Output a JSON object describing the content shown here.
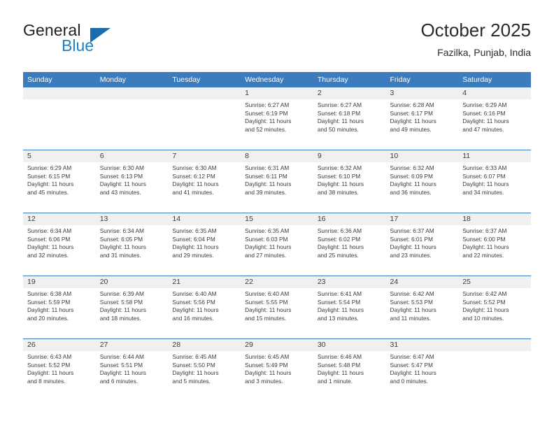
{
  "brand": {
    "name_part1": "General",
    "name_part2": "Blue",
    "triangle_color": "#1b6cad",
    "blue_color": "#1f7fc4"
  },
  "header": {
    "title": "October 2025",
    "subtitle": "Fazilka, Punjab, India"
  },
  "theme": {
    "header_blue": "#3a7cbe",
    "daynum_band": "#f0f0f0",
    "text": "#3b3b3b"
  },
  "weekday_headers": [
    "Sunday",
    "Monday",
    "Tuesday",
    "Wednesday",
    "Thursday",
    "Friday",
    "Saturday"
  ],
  "weeks": [
    [
      {
        "day": "",
        "sunrise": "",
        "sunset": "",
        "daylight_line1": "",
        "daylight_line2": ""
      },
      {
        "day": "",
        "sunrise": "",
        "sunset": "",
        "daylight_line1": "",
        "daylight_line2": ""
      },
      {
        "day": "",
        "sunrise": "",
        "sunset": "",
        "daylight_line1": "",
        "daylight_line2": ""
      },
      {
        "day": "1",
        "sunrise": "Sunrise: 6:27 AM",
        "sunset": "Sunset: 6:19 PM",
        "daylight_line1": "Daylight: 11 hours",
        "daylight_line2": "and 52 minutes."
      },
      {
        "day": "2",
        "sunrise": "Sunrise: 6:27 AM",
        "sunset": "Sunset: 6:18 PM",
        "daylight_line1": "Daylight: 11 hours",
        "daylight_line2": "and 50 minutes."
      },
      {
        "day": "3",
        "sunrise": "Sunrise: 6:28 AM",
        "sunset": "Sunset: 6:17 PM",
        "daylight_line1": "Daylight: 11 hours",
        "daylight_line2": "and 49 minutes."
      },
      {
        "day": "4",
        "sunrise": "Sunrise: 6:29 AM",
        "sunset": "Sunset: 6:16 PM",
        "daylight_line1": "Daylight: 11 hours",
        "daylight_line2": "and 47 minutes."
      }
    ],
    [
      {
        "day": "5",
        "sunrise": "Sunrise: 6:29 AM",
        "sunset": "Sunset: 6:15 PM",
        "daylight_line1": "Daylight: 11 hours",
        "daylight_line2": "and 45 minutes."
      },
      {
        "day": "6",
        "sunrise": "Sunrise: 6:30 AM",
        "sunset": "Sunset: 6:13 PM",
        "daylight_line1": "Daylight: 11 hours",
        "daylight_line2": "and 43 minutes."
      },
      {
        "day": "7",
        "sunrise": "Sunrise: 6:30 AM",
        "sunset": "Sunset: 6:12 PM",
        "daylight_line1": "Daylight: 11 hours",
        "daylight_line2": "and 41 minutes."
      },
      {
        "day": "8",
        "sunrise": "Sunrise: 6:31 AM",
        "sunset": "Sunset: 6:11 PM",
        "daylight_line1": "Daylight: 11 hours",
        "daylight_line2": "and 39 minutes."
      },
      {
        "day": "9",
        "sunrise": "Sunrise: 6:32 AM",
        "sunset": "Sunset: 6:10 PM",
        "daylight_line1": "Daylight: 11 hours",
        "daylight_line2": "and 38 minutes."
      },
      {
        "day": "10",
        "sunrise": "Sunrise: 6:32 AM",
        "sunset": "Sunset: 6:09 PM",
        "daylight_line1": "Daylight: 11 hours",
        "daylight_line2": "and 36 minutes."
      },
      {
        "day": "11",
        "sunrise": "Sunrise: 6:33 AM",
        "sunset": "Sunset: 6:07 PM",
        "daylight_line1": "Daylight: 11 hours",
        "daylight_line2": "and 34 minutes."
      }
    ],
    [
      {
        "day": "12",
        "sunrise": "Sunrise: 6:34 AM",
        "sunset": "Sunset: 6:06 PM",
        "daylight_line1": "Daylight: 11 hours",
        "daylight_line2": "and 32 minutes."
      },
      {
        "day": "13",
        "sunrise": "Sunrise: 6:34 AM",
        "sunset": "Sunset: 6:05 PM",
        "daylight_line1": "Daylight: 11 hours",
        "daylight_line2": "and 31 minutes."
      },
      {
        "day": "14",
        "sunrise": "Sunrise: 6:35 AM",
        "sunset": "Sunset: 6:04 PM",
        "daylight_line1": "Daylight: 11 hours",
        "daylight_line2": "and 29 minutes."
      },
      {
        "day": "15",
        "sunrise": "Sunrise: 6:35 AM",
        "sunset": "Sunset: 6:03 PM",
        "daylight_line1": "Daylight: 11 hours",
        "daylight_line2": "and 27 minutes."
      },
      {
        "day": "16",
        "sunrise": "Sunrise: 6:36 AM",
        "sunset": "Sunset: 6:02 PM",
        "daylight_line1": "Daylight: 11 hours",
        "daylight_line2": "and 25 minutes."
      },
      {
        "day": "17",
        "sunrise": "Sunrise: 6:37 AM",
        "sunset": "Sunset: 6:01 PM",
        "daylight_line1": "Daylight: 11 hours",
        "daylight_line2": "and 23 minutes."
      },
      {
        "day": "18",
        "sunrise": "Sunrise: 6:37 AM",
        "sunset": "Sunset: 6:00 PM",
        "daylight_line1": "Daylight: 11 hours",
        "daylight_line2": "and 22 minutes."
      }
    ],
    [
      {
        "day": "19",
        "sunrise": "Sunrise: 6:38 AM",
        "sunset": "Sunset: 5:59 PM",
        "daylight_line1": "Daylight: 11 hours",
        "daylight_line2": "and 20 minutes."
      },
      {
        "day": "20",
        "sunrise": "Sunrise: 6:39 AM",
        "sunset": "Sunset: 5:58 PM",
        "daylight_line1": "Daylight: 11 hours",
        "daylight_line2": "and 18 minutes."
      },
      {
        "day": "21",
        "sunrise": "Sunrise: 6:40 AM",
        "sunset": "Sunset: 5:56 PM",
        "daylight_line1": "Daylight: 11 hours",
        "daylight_line2": "and 16 minutes."
      },
      {
        "day": "22",
        "sunrise": "Sunrise: 6:40 AM",
        "sunset": "Sunset: 5:55 PM",
        "daylight_line1": "Daylight: 11 hours",
        "daylight_line2": "and 15 minutes."
      },
      {
        "day": "23",
        "sunrise": "Sunrise: 6:41 AM",
        "sunset": "Sunset: 5:54 PM",
        "daylight_line1": "Daylight: 11 hours",
        "daylight_line2": "and 13 minutes."
      },
      {
        "day": "24",
        "sunrise": "Sunrise: 6:42 AM",
        "sunset": "Sunset: 5:53 PM",
        "daylight_line1": "Daylight: 11 hours",
        "daylight_line2": "and 11 minutes."
      },
      {
        "day": "25",
        "sunrise": "Sunrise: 6:42 AM",
        "sunset": "Sunset: 5:52 PM",
        "daylight_line1": "Daylight: 11 hours",
        "daylight_line2": "and 10 minutes."
      }
    ],
    [
      {
        "day": "26",
        "sunrise": "Sunrise: 6:43 AM",
        "sunset": "Sunset: 5:52 PM",
        "daylight_line1": "Daylight: 11 hours",
        "daylight_line2": "and 8 minutes."
      },
      {
        "day": "27",
        "sunrise": "Sunrise: 6:44 AM",
        "sunset": "Sunset: 5:51 PM",
        "daylight_line1": "Daylight: 11 hours",
        "daylight_line2": "and 6 minutes."
      },
      {
        "day": "28",
        "sunrise": "Sunrise: 6:45 AM",
        "sunset": "Sunset: 5:50 PM",
        "daylight_line1": "Daylight: 11 hours",
        "daylight_line2": "and 5 minutes."
      },
      {
        "day": "29",
        "sunrise": "Sunrise: 6:45 AM",
        "sunset": "Sunset: 5:49 PM",
        "daylight_line1": "Daylight: 11 hours",
        "daylight_line2": "and 3 minutes."
      },
      {
        "day": "30",
        "sunrise": "Sunrise: 6:46 AM",
        "sunset": "Sunset: 5:48 PM",
        "daylight_line1": "Daylight: 11 hours",
        "daylight_line2": "and 1 minute."
      },
      {
        "day": "31",
        "sunrise": "Sunrise: 6:47 AM",
        "sunset": "Sunset: 5:47 PM",
        "daylight_line1": "Daylight: 11 hours",
        "daylight_line2": "and 0 minutes."
      },
      {
        "day": "",
        "sunrise": "",
        "sunset": "",
        "daylight_line1": "",
        "daylight_line2": ""
      }
    ]
  ]
}
